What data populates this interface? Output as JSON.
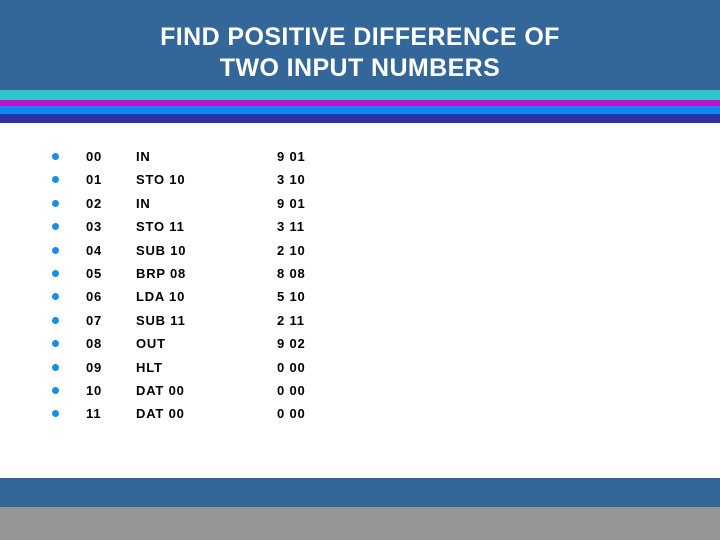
{
  "slide": {
    "title_lines": [
      "FIND POSITIVE DIFFERENCE OF",
      "TWO INPUT NUMBERS"
    ],
    "colors": {
      "header_band": "#336699",
      "stripe_teal": "#2fc4c8",
      "stripe_magenta": "#c010cf",
      "stripe_blue": "#0f87f0",
      "stripe_indigo": "#2e32a0",
      "bullet": "#1a8fe0",
      "body_background": "#ffffff",
      "text": "#000000",
      "footer_blue": "#336699",
      "footer_gray": "#959595"
    }
  },
  "program": {
    "rows": [
      {
        "address": "00",
        "mnemonic": "IN",
        "machine": "9 01"
      },
      {
        "address": "01",
        "mnemonic": "STO 10",
        "machine": "3 10"
      },
      {
        "address": "02",
        "mnemonic": "IN",
        "machine": "9 01"
      },
      {
        "address": "03",
        "mnemonic": "STO 11",
        "machine": "3 11"
      },
      {
        "address": "04",
        "mnemonic": "SUB 10",
        "machine": "2 10"
      },
      {
        "address": "05",
        "mnemonic": "BRP 08",
        "machine": "8 08"
      },
      {
        "address": "06",
        "mnemonic": "LDA 10",
        "machine": "5 10"
      },
      {
        "address": "07",
        "mnemonic": "SUB 11",
        "machine": "2 11"
      },
      {
        "address": "08",
        "mnemonic": "OUT",
        "machine": "9 02"
      },
      {
        "address": "09",
        "mnemonic": "HLT",
        "machine": "0 00"
      },
      {
        "address": "10",
        "mnemonic": "DAT 00",
        "machine": "0 00"
      },
      {
        "address": "11",
        "mnemonic": "DAT 00",
        "machine": "0 00"
      }
    ]
  }
}
